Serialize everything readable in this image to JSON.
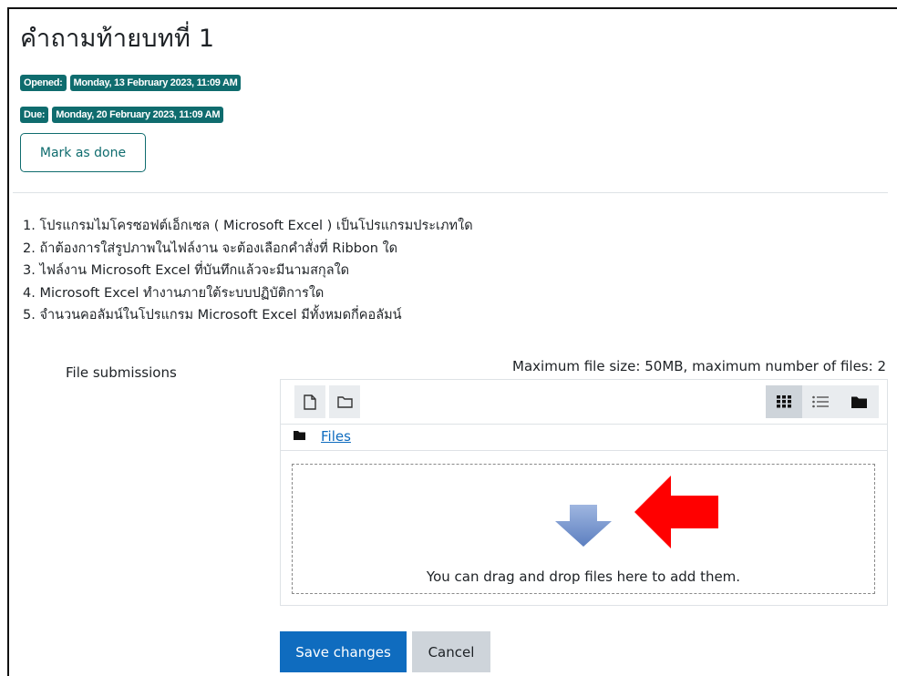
{
  "page_title": "คำถามท้ายบทที่ 1",
  "dates": {
    "opened_label": "Opened:",
    "opened_value": "Monday, 13 February 2023, 11:09 AM",
    "due_label": "Due:",
    "due_value": "Monday, 20 February 2023, 11:09 AM"
  },
  "mark_done_label": "Mark as done",
  "questions": [
    "1. โปรแกรมไมโครซอฟต์เอ็กเซล ( Microsoft Excel ) เป็นโปรแกรมประเภทใด",
    "2. ถ้าต้องการใส่รูปภาพในไฟล์งาน จะต้องเลือกคำสั่งที่ Ribbon ใด",
    "3. ไฟล์งาน Microsoft Excel ที่บันทึกแล้วจะมีนามสกุลใด",
    "4.  Microsoft Excel ทำงานภายใต้ระบบปฏิบัติการใด",
    "5. จำนวนคอลัมน์ในโปรแกรม Microsoft Excel มีทั้งหมดกี่คอลัมน์"
  ],
  "file_submissions": {
    "label": "File submissions",
    "limits": "Maximum file size: 50MB, maximum number of files: 2",
    "path_label": "Files",
    "drop_text": "You can drag and drop files here to add them."
  },
  "icons": {
    "add_file": "file-icon",
    "create_folder": "folder-icon",
    "view_grid": "grid-icon",
    "view_list": "list-icon",
    "view_tree": "folder-tree-icon"
  },
  "colors": {
    "badge": "#0f6c6e",
    "primary": "#0f6cbf",
    "annotation_arrow": "#ff0000",
    "drop_arrow": "#6f8fc8"
  },
  "buttons": {
    "save": "Save changes",
    "cancel": "Cancel"
  }
}
